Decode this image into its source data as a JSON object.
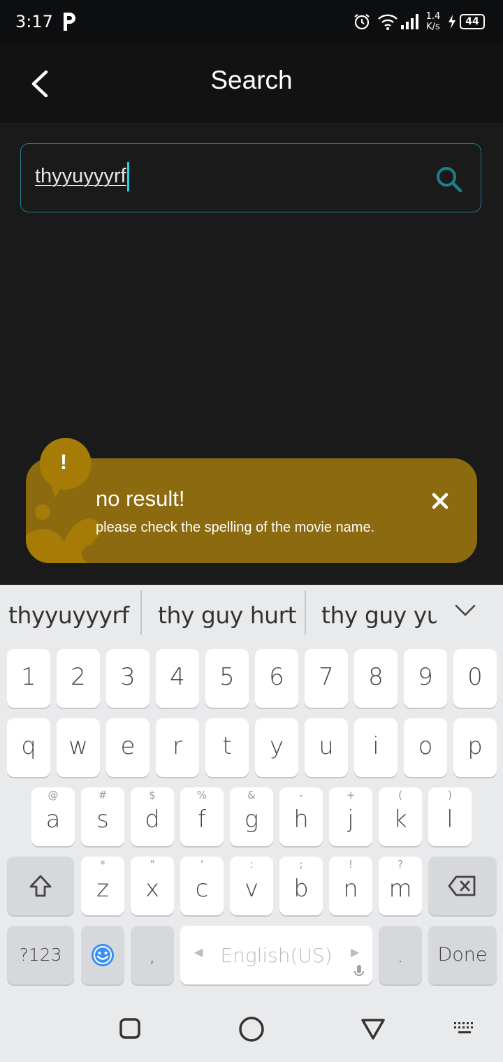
{
  "status_bar": {
    "time": "3:17",
    "net_speed_top": "1.4",
    "net_speed_bottom": "K/s",
    "battery": "44"
  },
  "header": {
    "title": "Search"
  },
  "search": {
    "value": "thyyuyyyrf"
  },
  "toast": {
    "icon": "!",
    "title": "no result!",
    "message": "please check the spelling of the movie name.",
    "color": "#8c6a10"
  },
  "keyboard": {
    "suggestions": [
      "thyyuyyyrf",
      "thy guy hurt",
      "thy guy yu"
    ],
    "number_row": [
      "1",
      "2",
      "3",
      "4",
      "5",
      "6",
      "7",
      "8",
      "9",
      "0"
    ],
    "row_q": [
      "q",
      "w",
      "e",
      "r",
      "t",
      "y",
      "u",
      "i",
      "o",
      "p"
    ],
    "row_a": [
      {
        "key": "a",
        "hint": "@"
      },
      {
        "key": "s",
        "hint": "#"
      },
      {
        "key": "d",
        "hint": "$"
      },
      {
        "key": "f",
        "hint": "%"
      },
      {
        "key": "g",
        "hint": "&"
      },
      {
        "key": "h",
        "hint": "-"
      },
      {
        "key": "j",
        "hint": "+"
      },
      {
        "key": "k",
        "hint": "("
      },
      {
        "key": "l",
        "hint": ")"
      }
    ],
    "row_z": [
      {
        "key": "z",
        "hint": "*"
      },
      {
        "key": "x",
        "hint": "\""
      },
      {
        "key": "c",
        "hint": "'"
      },
      {
        "key": "v",
        "hint": ":"
      },
      {
        "key": "b",
        "hint": ";"
      },
      {
        "key": "n",
        "hint": "!"
      },
      {
        "key": "m",
        "hint": "?"
      }
    ],
    "symbols_label": "?123",
    "comma_label": ",",
    "space_label": "English(US)",
    "period_label": ".",
    "done_label": "Done"
  },
  "colors": {
    "accent": "#1c7f8e",
    "caret": "#2ad0e6"
  }
}
